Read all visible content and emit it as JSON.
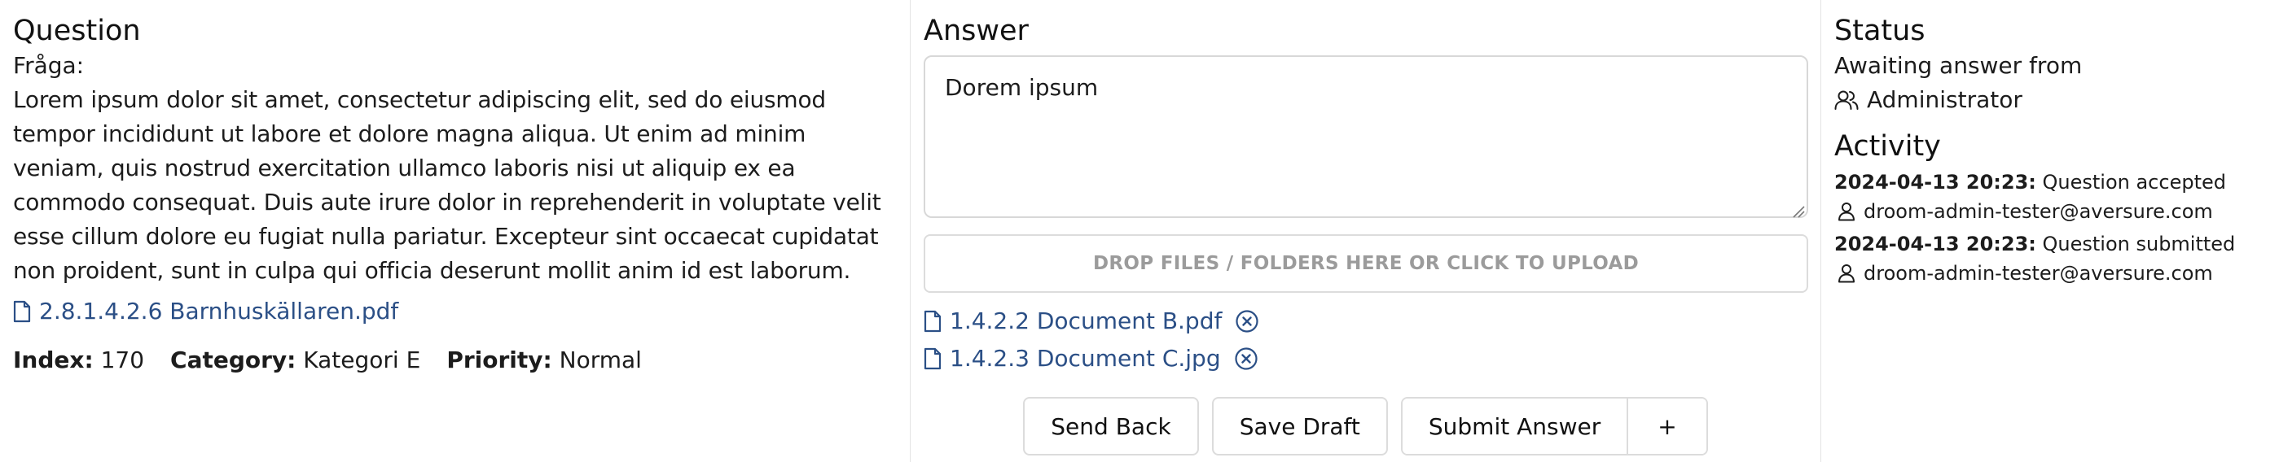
{
  "question": {
    "heading": "Question",
    "label": "Fråga:",
    "text": "Lorem ipsum dolor sit amet, consectetur adipiscing elit, sed do eiusmod tempor incididunt ut labore et dolore magna aliqua. Ut enim ad minim veniam, quis nostrud exercitation ullamco laboris nisi ut aliquip ex ea commodo consequat. Duis aute irure dolor in reprehenderit in voluptate velit esse cillum dolore eu fugiat nulla pariatur. Excepteur sint occaecat cupidatat non proident, sunt in culpa qui officia deserunt mollit anim id est laborum.",
    "attachment": "2.8.1.4.2.6 Barnhuskällaren.pdf",
    "meta": {
      "index_key": "Index:",
      "index_value": "170",
      "category_key": "Category:",
      "category_value": "Kategori E",
      "priority_key": "Priority:",
      "priority_value": "Normal"
    }
  },
  "answer": {
    "heading": "Answer",
    "value": "Dorem ipsum",
    "dropzone_label": "DROP FILES / FOLDERS HERE OR CLICK TO UPLOAD",
    "attachments": [
      "1.4.2.2 Document B.pdf",
      "1.4.2.3 Document C.jpg"
    ],
    "buttons": {
      "send_back": "Send Back",
      "save_draft": "Save Draft",
      "submit": "Submit Answer",
      "more": "+"
    }
  },
  "status": {
    "heading": "Status",
    "awaiting_text": "Awaiting answer from",
    "assignee": "Administrator",
    "activity_heading": "Activity",
    "activity": [
      {
        "timestamp": "2024-04-13 20:23:",
        "event": " Question accepted",
        "user": "droom-admin-tester@aversure.com"
      },
      {
        "timestamp": "2024-04-13 20:23:",
        "event": " Question submitted",
        "user": "droom-admin-tester@aversure.com"
      }
    ]
  },
  "colors": {
    "link": "#2b4f86",
    "border": "#dcdcdc",
    "muted": "#9b9b9b"
  },
  "icons": {
    "file": "file-icon",
    "remove": "remove-circle-icon",
    "user": "user-icon",
    "users": "users-icon"
  }
}
